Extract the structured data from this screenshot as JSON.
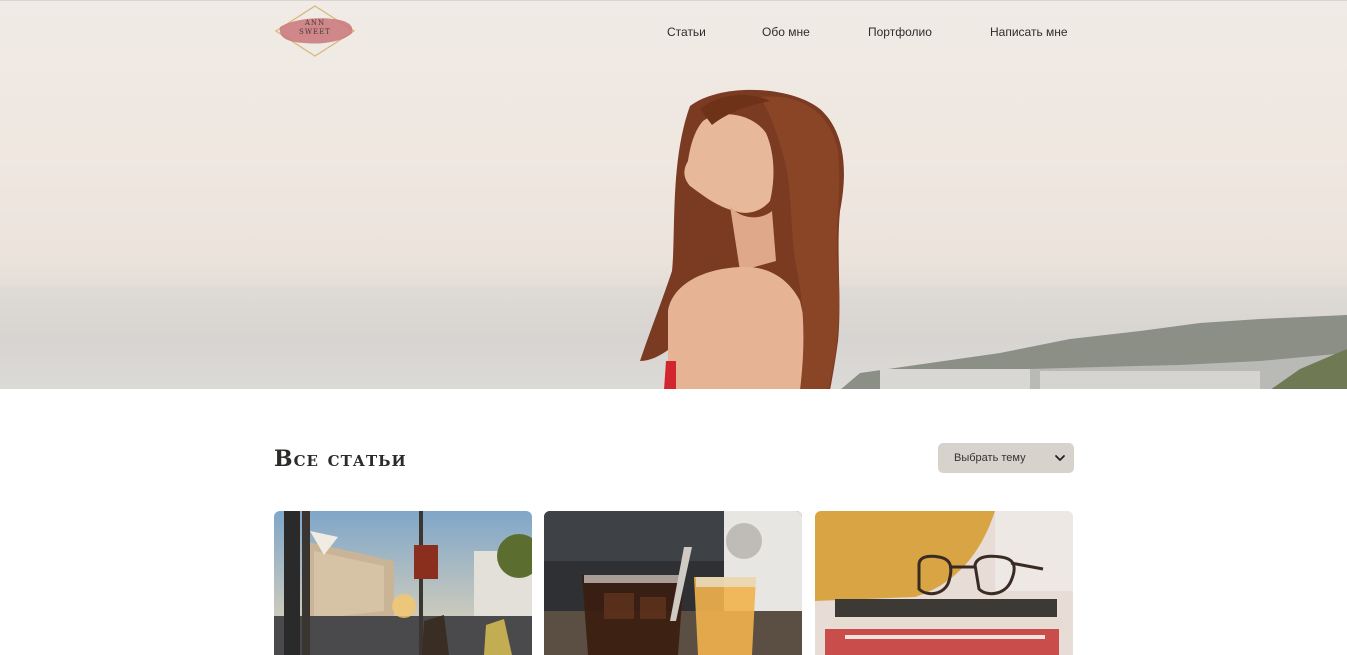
{
  "logo": {
    "text_line1": "ANN",
    "text_line2": "SWEET"
  },
  "nav": {
    "items": [
      {
        "label": "Статьи"
      },
      {
        "label": "Обо мне"
      },
      {
        "label": "Портфолио"
      },
      {
        "label": "Написать мне"
      }
    ]
  },
  "main": {
    "title": "Все статьи",
    "topic_select": {
      "selected": "Выбрать тему"
    }
  },
  "colors": {
    "accent_select": "#d8d2cc",
    "title": "#2c2b29",
    "logo_pink": "#c9757a",
    "logo_gold": "#d8b774"
  },
  "icons": [
    "chevron-down-icon"
  ],
  "articles": [
    {
      "image": "city-street-photo"
    },
    {
      "image": "iced-drinks-photo"
    },
    {
      "image": "books-glasses-photo"
    }
  ]
}
